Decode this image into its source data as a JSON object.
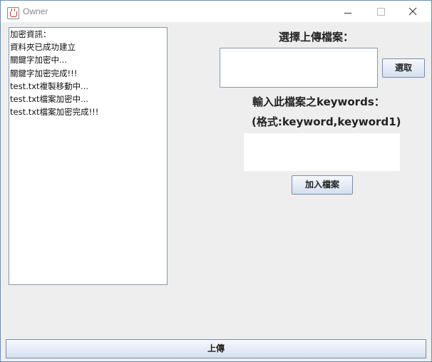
{
  "window": {
    "title": "Owner",
    "icon": "java-cup-icon"
  },
  "log": {
    "lines": [
      "加密資訊：",
      "資料夾已成功建立",
      "關鍵字加密中...",
      "關鍵字加密完成!!!",
      "test.txt複製移動中...",
      "test.txt檔案加密中...",
      "test.txt檔案加密完成!!!"
    ]
  },
  "upload_panel": {
    "select_label": "選擇上傳檔案：",
    "choose_button": "選取",
    "selected_file": "",
    "keywords_label": "輸入此檔案之keywords：",
    "format_label": "(格式:keyword,keyword1)",
    "keywords_value": "",
    "add_button": "加入檔案"
  },
  "footer": {
    "upload_button": "上傳"
  }
}
